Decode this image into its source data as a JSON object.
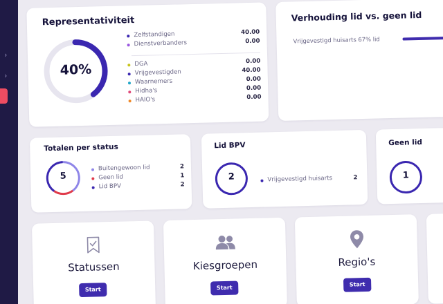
{
  "representativiteit": {
    "title": "Representativiteit",
    "percent": "40%",
    "percent_value": 0.4,
    "group1": [
      {
        "label": "Zelfstandigen",
        "value": "40.00",
        "color": "#3a27b0"
      },
      {
        "label": "Dienstverbanders",
        "value": "0.00",
        "color": "#9a57e0"
      }
    ],
    "group2": [
      {
        "label": "DGA",
        "value": "0.00",
        "color": "#c7c41b"
      },
      {
        "label": "Vrijgevestigden",
        "value": "40.00",
        "color": "#3a27b0"
      },
      {
        "label": "Waarnemers",
        "value": "0.00",
        "color": "#22a7c9"
      },
      {
        "label": "Hidha's",
        "value": "0.00",
        "color": "#e0497a"
      },
      {
        "label": "HAIO's",
        "value": "0.00",
        "color": "#f08a2a"
      }
    ]
  },
  "verhouding": {
    "title": "Verhouding lid vs. geen lid",
    "line": "Vrijgevestigd huisarts 67% lid",
    "lid_fraction": 0.67
  },
  "totalen": {
    "title": "Totalen per status",
    "total": "5",
    "items": [
      {
        "label": "Buitengewoon lid",
        "value": "2",
        "color": "#8f86e8"
      },
      {
        "label": "Geen lid",
        "value": "1",
        "color": "#e03a4a"
      },
      {
        "label": "Lid BPV",
        "value": "2",
        "color": "#3a27b0"
      }
    ]
  },
  "lid_bpv": {
    "title": "Lid BPV",
    "total": "2",
    "items": [
      {
        "label": "Vrijgevestigd huisarts",
        "value": "2",
        "color": "#3a27b0"
      }
    ]
  },
  "geen_lid": {
    "title": "Geen lid",
    "total": "1"
  },
  "tiles": [
    {
      "label": "Statussen",
      "button": "Start",
      "icon": "bookmark-check-icon"
    },
    {
      "label": "Kiesgroepen",
      "button": "Start",
      "icon": "users-icon"
    },
    {
      "label": "Regio's",
      "button": "Start",
      "icon": "map-pin-icon"
    }
  ],
  "colors": {
    "accent": "#3f2cae",
    "sidebar": "#1f1a45",
    "active": "#ee4c62"
  }
}
